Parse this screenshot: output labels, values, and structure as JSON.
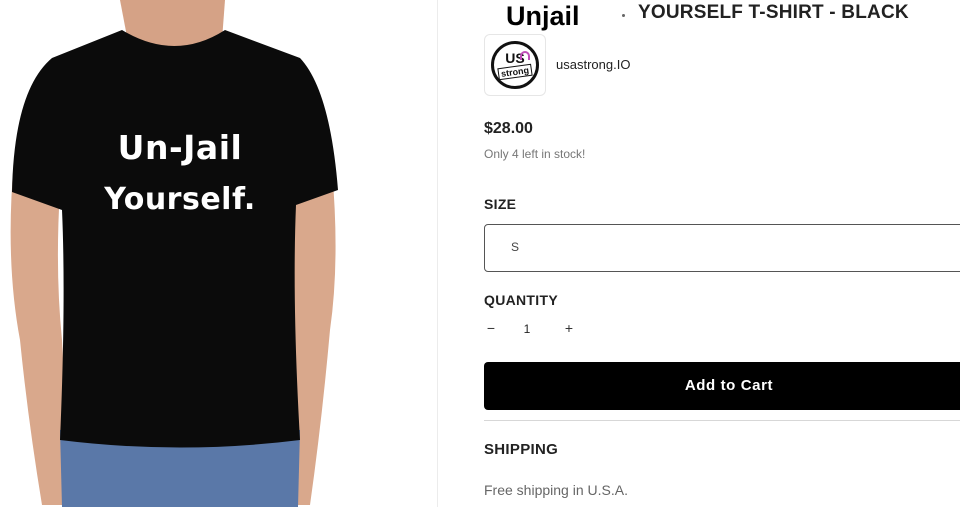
{
  "product": {
    "title_overlay": "Unjail",
    "title": "YOURSELF T-SHIRT - BLACK",
    "price": "$28.00",
    "stock": "Only 4 left in stock!",
    "shirt_text": {
      "line1": "Un-Jail",
      "line2": "Yourself."
    }
  },
  "vendor": {
    "logo_top": "US",
    "logo_bottom": "strong",
    "name": "usastrong.IO"
  },
  "size": {
    "label": "SIZE",
    "value": "S"
  },
  "quantity": {
    "label": "QUANTITY",
    "minus": "−",
    "value": "1",
    "plus": "+"
  },
  "cart": {
    "label": "Add to Cart"
  },
  "shipping": {
    "label": "SHIPPING",
    "text": "Free shipping in U.S.A."
  },
  "colors": {
    "shirt": "#0b0b0b",
    "skin": "#d9a88c",
    "jeans": "#5a78a8",
    "button": "#000000"
  },
  "icons": {
    "vendor_logo": "usa-strong-logo"
  }
}
